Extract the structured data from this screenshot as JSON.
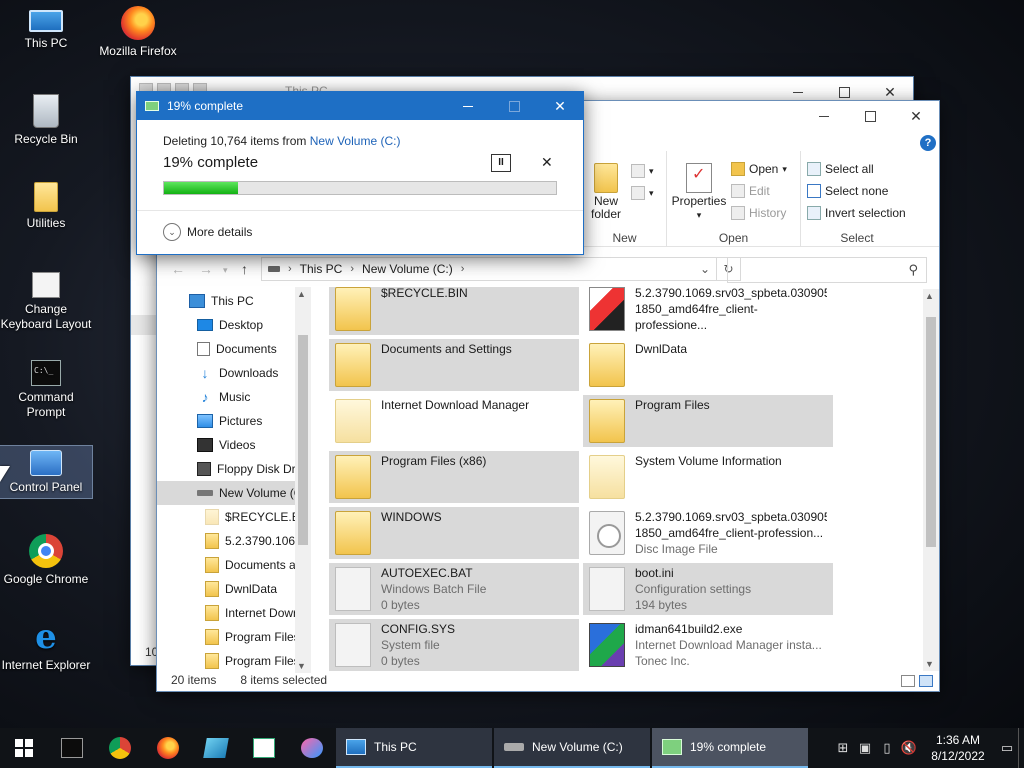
{
  "desktop": {
    "icons": [
      {
        "label": "This PC",
        "icon": "computer-icon"
      },
      {
        "label": "Mozilla Firefox",
        "icon": "firefox-icon"
      },
      {
        "label": "Recycle Bin",
        "icon": "recycle-bin-icon"
      },
      {
        "label": "Utilities",
        "icon": "folder-icon"
      },
      {
        "label": "Change Keyboard Layout",
        "icon": "keyboard-icon"
      },
      {
        "label": "Command Prompt",
        "icon": "command-prompt-icon"
      },
      {
        "label": "Control Panel",
        "icon": "control-panel-icon"
      },
      {
        "label": "Google Chrome",
        "icon": "chrome-icon"
      },
      {
        "label": "Internet Explorer",
        "icon": "internet-explorer-icon"
      }
    ]
  },
  "back_window": {
    "title": "This PC",
    "status_fragment": "10"
  },
  "explorer": {
    "ribbon": {
      "new_group": {
        "label": "New",
        "new_folder": "New folder"
      },
      "open_group": {
        "label": "Open",
        "properties": "Properties",
        "open": "Open",
        "edit": "Edit",
        "history": "History"
      },
      "select_group": {
        "label": "Select",
        "select_all": "Select all",
        "select_none": "Select none",
        "invert_selection": "Invert selection"
      }
    },
    "address": {
      "crumbs": [
        "This PC",
        "New Volume (C:)"
      ]
    },
    "search": {
      "placeholder": ""
    },
    "nav_pane": [
      {
        "label": "This PC",
        "icon": "computer-icon"
      },
      {
        "label": "Desktop",
        "icon": "desktop-icon"
      },
      {
        "label": "Documents",
        "icon": "documents-icon"
      },
      {
        "label": "Downloads",
        "icon": "downloads-icon"
      },
      {
        "label": "Music",
        "icon": "music-icon"
      },
      {
        "label": "Pictures",
        "icon": "pictures-icon"
      },
      {
        "label": "Videos",
        "icon": "videos-icon"
      },
      {
        "label": "Floppy Disk Dri",
        "icon": "floppy-icon"
      },
      {
        "label": "New Volume (C",
        "icon": "drive-icon",
        "selected": true
      },
      {
        "label": "$RECYCLE.BIN",
        "icon": "folder-icon"
      },
      {
        "label": "5.2.3790.1069",
        "icon": "folder-icon"
      },
      {
        "label": "Documents a",
        "icon": "folder-icon"
      },
      {
        "label": "DwnlData",
        "icon": "folder-icon"
      },
      {
        "label": "Internet Dowr",
        "icon": "folder-icon"
      },
      {
        "label": "Program Files",
        "icon": "folder-icon"
      },
      {
        "label": "Program Files",
        "icon": "folder-icon"
      }
    ],
    "items": [
      {
        "name": "$RECYCLE.BIN",
        "line2": "",
        "line3": "",
        "icon": "folder",
        "selected": true
      },
      {
        "name": "5.2.3790.1069.srv03_spbeta.030905-",
        "line2": "1850_amd64fre_client-professione...",
        "line3": "",
        "icon": "media",
        "selected": false
      },
      {
        "name": "Documents and Settings",
        "line2": "",
        "line3": "",
        "icon": "folder",
        "selected": true
      },
      {
        "name": "DwnlData",
        "line2": "",
        "line3": "",
        "icon": "folder",
        "selected": false
      },
      {
        "name": "Internet Download Manager",
        "line2": "",
        "line3": "",
        "icon": "folder-ghost",
        "selected": false
      },
      {
        "name": "Program Files",
        "line2": "",
        "line3": "",
        "icon": "folder",
        "selected": true
      },
      {
        "name": "Program Files (x86)",
        "line2": "",
        "line3": "",
        "icon": "folder",
        "selected": true
      },
      {
        "name": "System Volume Information",
        "line2": "",
        "line3": "",
        "icon": "folder-ghost",
        "selected": false
      },
      {
        "name": "WINDOWS",
        "line2": "",
        "line3": "",
        "icon": "folder",
        "selected": true
      },
      {
        "name": "5.2.3790.1069.srv03_spbeta.030905-",
        "line2": "1850_amd64fre_client-profession...",
        "line3": "Disc Image File",
        "icon": "disc",
        "selected": false
      },
      {
        "name": "AUTOEXEC.BAT",
        "line2": "Windows Batch File",
        "line3": "0 bytes",
        "icon": "sysfile",
        "selected": true
      },
      {
        "name": "boot.ini",
        "line2": "Configuration settings",
        "line3": "194 bytes",
        "icon": "sysfile",
        "selected": true
      },
      {
        "name": "CONFIG.SYS",
        "line2": "System file",
        "line3": "0 bytes",
        "icon": "sysfile",
        "selected": true
      },
      {
        "name": "idman641build2.exe",
        "line2": "Internet Download Manager insta...",
        "line3": "Tonec Inc.",
        "icon": "idm",
        "selected": false
      }
    ],
    "status": {
      "count": "20 items",
      "selected": "8 items selected"
    }
  },
  "progress_dialog": {
    "title": "19% complete",
    "desc_prefix": "Deleting 10,764 items from ",
    "desc_link": "New Volume (C:)",
    "heading": "19% complete",
    "progress": 0.19,
    "more_details": "More details"
  },
  "taskbar": {
    "pinned": [
      "command-prompt-icon",
      "chrome-icon",
      "firefox-icon",
      "notepad-icon",
      "chart-icon",
      "tool-icon"
    ],
    "tasks": [
      {
        "label": "This PC",
        "icon": "computer-icon"
      },
      {
        "label": "New Volume (C:)",
        "icon": "drive-icon"
      },
      {
        "label": "19% complete",
        "icon": "progress-icon",
        "active": true
      }
    ],
    "time": "1:36 AM",
    "date": "8/12/2022"
  }
}
